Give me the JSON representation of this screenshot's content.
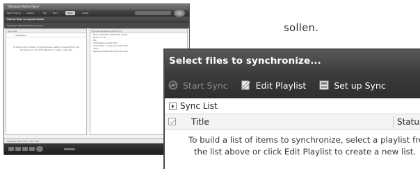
{
  "caption": "sollen.",
  "thumbnail": {
    "window_title": "Windows Media Player",
    "tabs": [
      "Now Playing",
      "Library",
      "Rip",
      "Burn",
      "Sync",
      "Guide"
    ],
    "selected_tab_index": 4,
    "header": "Select files to synchronize",
    "toolbar": "Start Sync   Edit Playlist   Set up Sync",
    "left_pane_header": "Sync List",
    "left_cols": "Title                    Status",
    "left_message": "To build a list of items to synchronize, select a playlist from the list above or click Edit Playlist to create a new list.",
    "right_pane_header": "Connected Device (Libre TV)",
    "right_items": [
      "Music (12345-67-1234-5678) 1,5 GB",
      "Bruce / Of TW",
      "Pop",
      "Unidentified: playlist (1/7)",
      "Unidentified -> Unknown (Dutch) 7m",
      "Video",
      "Media (12345-6-1234-5678) 21,2 GB"
    ],
    "footer": "Capacity: Total Free 1,08 / Free"
  },
  "zoom": {
    "header": "Select files to synchronize...",
    "toolbar": {
      "start_sync": "Start Sync",
      "edit_playlist": "Edit Playlist",
      "setup_sync": "Set up Sync"
    },
    "sync_list_label": "Sync List",
    "columns": {
      "title": "Title",
      "status": "Status"
    },
    "empty_message": {
      "line1": "To build a list of items to synchronize, select a playlist from",
      "line2": "the list above or click Edit Playlist to create a new list."
    }
  }
}
